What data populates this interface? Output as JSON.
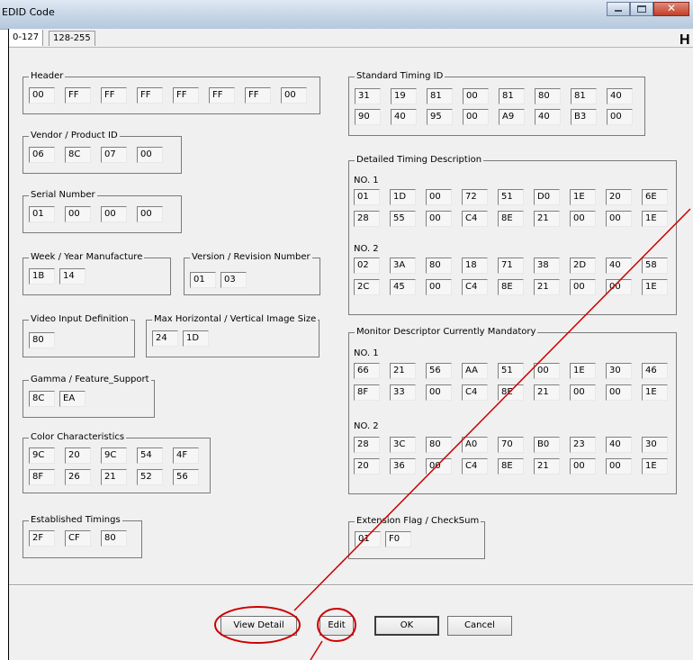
{
  "window": {
    "title": "EDID Code"
  },
  "tabs": [
    {
      "label": "0-127"
    },
    {
      "label": "128-255"
    }
  ],
  "header_cut": "H",
  "groups": {
    "header": {
      "label": "Header",
      "rows": [
        [
          "00",
          "FF",
          "FF",
          "FF",
          "FF",
          "FF",
          "FF",
          "00"
        ]
      ]
    },
    "vendor": {
      "label": "Vendor / Product ID",
      "rows": [
        [
          "06",
          "8C",
          "07",
          "00"
        ]
      ]
    },
    "serial": {
      "label": "Serial Number",
      "rows": [
        [
          "01",
          "00",
          "00",
          "00"
        ]
      ]
    },
    "week": {
      "label": "Week / Year Manufacture",
      "rows": [
        [
          "1B",
          "14"
        ]
      ]
    },
    "version": {
      "label": "Version / Revision Number",
      "rows": [
        [
          "01",
          "03"
        ]
      ]
    },
    "video": {
      "label": "Video Input Definition",
      "rows": [
        [
          "80"
        ]
      ]
    },
    "maximg": {
      "label": "Max Horizontal / Vertical Image Size",
      "rows": [
        [
          "24",
          "1D"
        ]
      ]
    },
    "gamma": {
      "label": "Gamma / Feature_Support",
      "rows": [
        [
          "8C",
          "EA"
        ]
      ]
    },
    "color": {
      "label": "Color Characteristics",
      "rows": [
        [
          "9C",
          "20",
          "9C",
          "54",
          "4F"
        ],
        [
          "8F",
          "26",
          "21",
          "52",
          "56"
        ]
      ]
    },
    "established": {
      "label": "Established Timings",
      "rows": [
        [
          "2F",
          "CF",
          "80"
        ]
      ]
    },
    "standard": {
      "label": "Standard Timing ID",
      "rows": [
        [
          "31",
          "19",
          "81",
          "00",
          "81",
          "80",
          "81",
          "40"
        ],
        [
          "90",
          "40",
          "95",
          "00",
          "A9",
          "40",
          "B3",
          "00"
        ]
      ]
    },
    "detailed": {
      "label": "Detailed Timing Description",
      "no1": {
        "label": "NO. 1",
        "rows": [
          [
            "01",
            "1D",
            "00",
            "72",
            "51",
            "D0",
            "1E",
            "20",
            "6E"
          ],
          [
            "28",
            "55",
            "00",
            "C4",
            "8E",
            "21",
            "00",
            "00",
            "1E"
          ]
        ]
      },
      "no2": {
        "label": "NO. 2",
        "rows": [
          [
            "02",
            "3A",
            "80",
            "18",
            "71",
            "38",
            "2D",
            "40",
            "58"
          ],
          [
            "2C",
            "45",
            "00",
            "C4",
            "8E",
            "21",
            "00",
            "00",
            "1E"
          ]
        ]
      }
    },
    "monitor": {
      "label": "Monitor Descriptor Currently Mandatory",
      "no1": {
        "label": "NO. 1",
        "rows": [
          [
            "66",
            "21",
            "56",
            "AA",
            "51",
            "00",
            "1E",
            "30",
            "46"
          ],
          [
            "8F",
            "33",
            "00",
            "C4",
            "8E",
            "21",
            "00",
            "00",
            "1E"
          ]
        ]
      },
      "no2": {
        "label": "NO. 2",
        "rows": [
          [
            "28",
            "3C",
            "80",
            "A0",
            "70",
            "B0",
            "23",
            "40",
            "30"
          ],
          [
            "20",
            "36",
            "00",
            "C4",
            "8E",
            "21",
            "00",
            "00",
            "1E"
          ]
        ]
      }
    },
    "extension": {
      "label": "Extension Flag / CheckSum",
      "rows": [
        [
          "01",
          "F0"
        ]
      ]
    }
  },
  "buttons": {
    "view_detail": "View Detail",
    "edit": "Edit",
    "ok": "OK",
    "cancel": "Cancel"
  },
  "colors": {
    "annotation": "#cc0000",
    "titlebar": "#c6d5e6",
    "dialog_bg": "#f0f0f0"
  }
}
